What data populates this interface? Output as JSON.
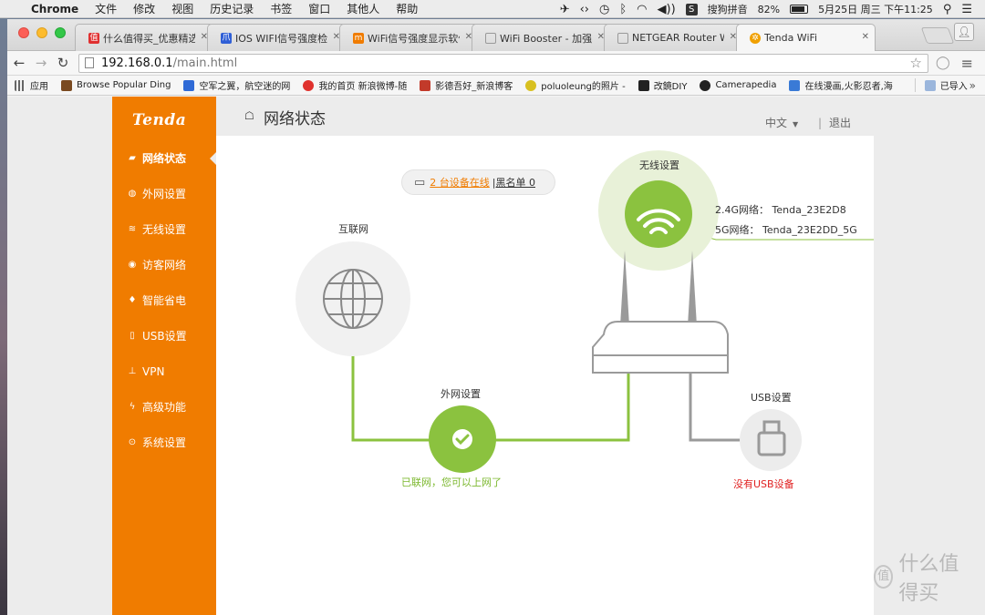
{
  "menubar": {
    "app_name": "Chrome",
    "items": [
      "文件",
      "修改",
      "视图",
      "历史记录",
      "书签",
      "窗口",
      "其他人",
      "帮助"
    ],
    "input_method": "搜狗拼音",
    "battery": "82%",
    "clock": "5月25日 周三 下午11:25"
  },
  "tabs": [
    {
      "label": "什么值得买_优惠精选 | 国内",
      "fav_color": "#e02f2f"
    },
    {
      "label": "IOS WIFI信号强度检测_百度",
      "fav_color": "#2f5fd6"
    },
    {
      "label": "WiFi信号强度显示软件 Wi",
      "fav_color": "#f07c00"
    },
    {
      "label": "WiFi Booster - 加强版WiF",
      "fav_color": "#9a9a9a"
    },
    {
      "label": "NETGEAR Router WNDR",
      "fav_color": "#9a9a9a"
    },
    {
      "label": "Tenda WiFi",
      "fav_color": "#f0a000"
    }
  ],
  "address": {
    "host": "192.168.0.1",
    "path": "/main.html"
  },
  "bookmarks": [
    {
      "label": "应用",
      "color": "#555555"
    },
    {
      "label": "Browse Popular Ding",
      "color": "#7a4a20"
    },
    {
      "label": "空军之翼，航空迷的网",
      "color": "#2f6ad6"
    },
    {
      "label": "我的首页 新浪微博-随",
      "color": "#e0322e"
    },
    {
      "label": "影德吾好_新浪博客",
      "color": "#c23a2a"
    },
    {
      "label": "poluoleung的照片 - ",
      "color": "#d8c020"
    },
    {
      "label": "改鏡DIY",
      "color": "#222222"
    },
    {
      "label": "Camerapedia",
      "color": "#222222"
    },
    {
      "label": "在线漫画,火影忍者,海",
      "color": "#3a7ad6"
    }
  ],
  "bookmarks_more": "已导入",
  "router": {
    "brand": "Tenda",
    "page_title": "网络状态",
    "language": "中文",
    "logout": "退出",
    "nav": [
      {
        "label": "网络状态",
        "icon": "router-icon"
      },
      {
        "label": "外网设置",
        "icon": "globe-icon"
      },
      {
        "label": "无线设置",
        "icon": "wifi-icon"
      },
      {
        "label": "访客网络",
        "icon": "guest-icon"
      },
      {
        "label": "智能省电",
        "icon": "bulb-icon"
      },
      {
        "label": "USB设置",
        "icon": "usb-icon"
      },
      {
        "label": "VPN",
        "icon": "vpn-icon"
      },
      {
        "label": "高级功能",
        "icon": "wrench-icon"
      },
      {
        "label": "系统设置",
        "icon": "gear-icon"
      }
    ],
    "internet_label": "互联网",
    "devices_online": "2 台设备在线",
    "blacklist": "黑名单 0",
    "wireless_label": "无线设置",
    "wifi_24": "2.4G网络：  Tenda_23E2D8",
    "wifi_5": "5G网络：  Tenda_23E2DD_5G",
    "wan_label": "外网设置",
    "wan_status": "已联网，您可以上网了",
    "usb_label": "USB设置",
    "usb_status": "没有USB设备"
  },
  "watermark": "什么值得买",
  "colors": {
    "accent": "#f07c00",
    "green": "#8bc23f",
    "red": "#e02020"
  }
}
